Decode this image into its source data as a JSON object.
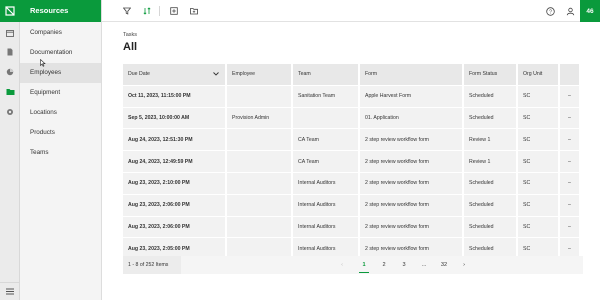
{
  "app": {
    "panel_title": "Resources",
    "notification_count": "46"
  },
  "rail": {
    "icons": [
      "logo-icon",
      "calendar-icon",
      "document-icon",
      "chart-icon",
      "folder-icon",
      "gear-icon",
      "menu-icon"
    ],
    "accent": "#0a9a3c"
  },
  "nav": {
    "items": [
      {
        "label": "Companies"
      },
      {
        "label": "Documentation"
      },
      {
        "label": "Employees"
      },
      {
        "label": "Equipment"
      },
      {
        "label": "Locations"
      },
      {
        "label": "Products"
      },
      {
        "label": "Teams"
      }
    ]
  },
  "page": {
    "breadcrumb": "Tasks",
    "title": "All"
  },
  "table": {
    "headers": {
      "due_date": "Due Date",
      "employee": "Employee",
      "team": "Team",
      "form": "Form",
      "form_status": "Form Status",
      "org_unit": "Org Unit"
    },
    "rows": [
      {
        "due": "Oct 11, 2023, 11:15:00 PM",
        "employee": "",
        "team": "Sanitation Team",
        "form": "Apple Harvest Form",
        "status": "Scheduled",
        "org": "SC",
        "more": "–"
      },
      {
        "due": "Sep 5, 2023, 10:00:00 AM",
        "employee": "Provision Admin",
        "team": "",
        "form": "01. Application",
        "status": "Scheduled",
        "org": "SC",
        "more": "–"
      },
      {
        "due": "Aug 24, 2023, 12:51:30 PM",
        "employee": "",
        "team": "CA Team",
        "form": "2 step review workflow form",
        "status": "Review 1",
        "org": "SC",
        "more": "–"
      },
      {
        "due": "Aug 24, 2023, 12:49:59 PM",
        "employee": "",
        "team": "CA Team",
        "form": "2 step review workflow form",
        "status": "Review 1",
        "org": "SC",
        "more": "–"
      },
      {
        "due": "Aug 23, 2023, 2:10:00 PM",
        "employee": "",
        "team": "Internal Auditors",
        "form": "2 step review workflow form",
        "status": "Scheduled",
        "org": "SC",
        "more": "–"
      },
      {
        "due": "Aug 23, 2023, 2:06:00 PM",
        "employee": "",
        "team": "Internal Auditors",
        "form": "2 step review workflow form",
        "status": "Scheduled",
        "org": "SC",
        "more": "–"
      },
      {
        "due": "Aug 23, 2023, 2:06:00 PM",
        "employee": "",
        "team": "Internal Auditors",
        "form": "2 step review workflow form",
        "status": "Scheduled",
        "org": "SC",
        "more": "–"
      },
      {
        "due": "Aug 23, 2023, 2:05:00 PM",
        "employee": "",
        "team": "Internal Auditors",
        "form": "2 step review workflow form",
        "status": "Scheduled",
        "org": "SC",
        "more": "–"
      }
    ]
  },
  "pagination": {
    "summary": "1 - 8 of 252 Items",
    "prev": "‹",
    "pages": [
      "1",
      "2",
      "3",
      "...",
      "32"
    ],
    "next": "›"
  }
}
